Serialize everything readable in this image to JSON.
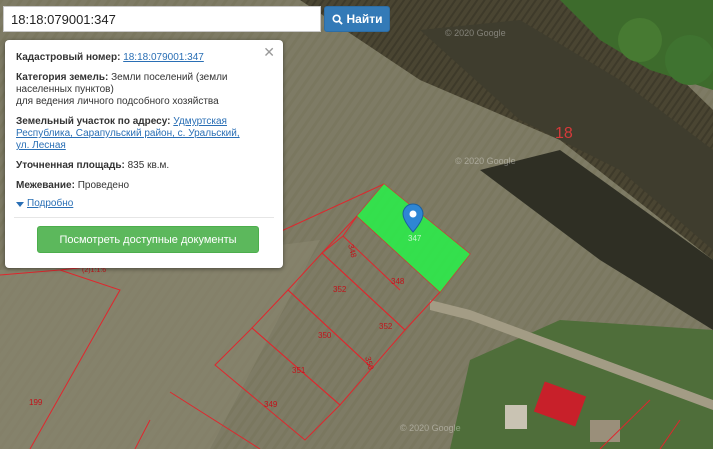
{
  "search": {
    "value": "18:18:079001:347",
    "button_label": "Найти"
  },
  "popup": {
    "cadastral_label": "Кадастровый номер:",
    "cadastral_value": "18:18:079001:347",
    "category_label": "Категория земель:",
    "category_value": "Земли поселений (земли населенных пунктов)",
    "category_use": "для ведения личного подсобного хозяйства",
    "address_label": "Земельный участок по адресу:",
    "address_value": "Удмуртская Республика, Сарапульский район, с. Уральский, ул. Лесная",
    "area_label": "Уточненная площадь:",
    "area_value": "835 кв.м.",
    "survey_label": "Межевание:",
    "survey_value": "Проведено",
    "more_link": "Подробно",
    "docs_button": "Посмотреть доступные документы"
  },
  "map": {
    "block_number": "18",
    "selected_plot_label": "347",
    "plot_labels": [
      "348",
      "348",
      "352",
      "352",
      "350",
      "350",
      "351",
      "349",
      "199",
      "(2)1:1:6"
    ],
    "watermarks": [
      "© 2020 Google",
      "© 2020 Google",
      "© 2020 Google"
    ],
    "colors": {
      "selected_plot": "#2ee84b",
      "boundary": "#e0262d",
      "marker": "#2e86d4",
      "block_number": "#d63a3a"
    }
  }
}
